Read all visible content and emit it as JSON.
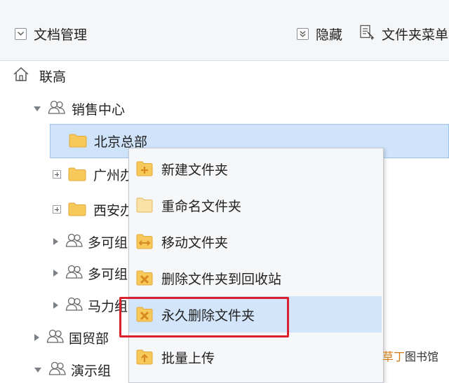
{
  "toolbar": {
    "doc_manage_label": "文档管理",
    "hide_label": "隐藏",
    "folder_menu_label": "文件夹菜单"
  },
  "tree": {
    "root": "联高",
    "nodes": [
      {
        "label": "销售中心",
        "type": "group"
      },
      {
        "label": "北京总部",
        "type": "folder"
      },
      {
        "label": "广州办",
        "type": "folder"
      },
      {
        "label": "西安办",
        "type": "folder"
      },
      {
        "label": "多可组",
        "type": "group"
      },
      {
        "label": "多可组",
        "type": "group"
      },
      {
        "label": "马力组",
        "type": "group"
      },
      {
        "label": "国贸部",
        "type": "group"
      },
      {
        "label": "演示组",
        "type": "group"
      }
    ]
  },
  "context_menu": {
    "items": [
      {
        "label": "新建文件夹",
        "icon": "new-folder-icon"
      },
      {
        "label": "重命名文件夹",
        "icon": "rename-folder-icon"
      },
      {
        "label": "移动文件夹",
        "icon": "move-folder-icon"
      },
      {
        "label": "删除文件夹到回收站",
        "icon": "delete-to-recycle-icon"
      },
      {
        "label": "永久删除文件夹",
        "icon": "permanent-delete-icon"
      },
      {
        "label": "批量上传",
        "icon": "batch-upload-icon"
      }
    ]
  },
  "watermark": {
    "accent": "草丁",
    "rest": "图书馆"
  },
  "colors": {
    "selection": "#cfe3fb",
    "highlight_border": "#d9202c",
    "folder": "#f7c95a"
  }
}
